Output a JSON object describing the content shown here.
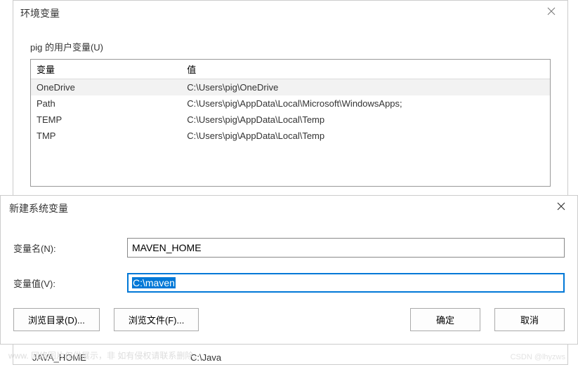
{
  "parent": {
    "title": "环境变量",
    "group_label": "pig 的用户变量(U)",
    "headers": {
      "variable": "变量",
      "value": "值"
    },
    "rows": [
      {
        "var": "OneDrive",
        "val": "C:\\Users\\pig\\OneDrive"
      },
      {
        "var": "Path",
        "val": "C:\\Users\\pig\\AppData\\Local\\Microsoft\\WindowsApps;"
      },
      {
        "var": "TEMP",
        "val": "C:\\Users\\pig\\AppData\\Local\\Temp"
      },
      {
        "var": "TMP",
        "val": "C:\\Users\\pig\\AppData\\Local\\Temp"
      }
    ]
  },
  "child": {
    "title": "新建系统变量",
    "name_label": "变量名(N):",
    "value_label": "变量值(V):",
    "name_value": "MAVEN_HOME",
    "value_value": "C:\\maven",
    "browse_dir": "浏览目录(D)...",
    "browse_file": "浏览文件(F)...",
    "ok": "确定",
    "cancel": "取消"
  },
  "bg_row": {
    "var": "JAVA_HOME",
    "val": "C:\\Java"
  },
  "watermark_left": "www.         网络图片仅供展示，非        如有侵权请联系删除。",
  "watermark_right": "CSDN @lhyzws"
}
